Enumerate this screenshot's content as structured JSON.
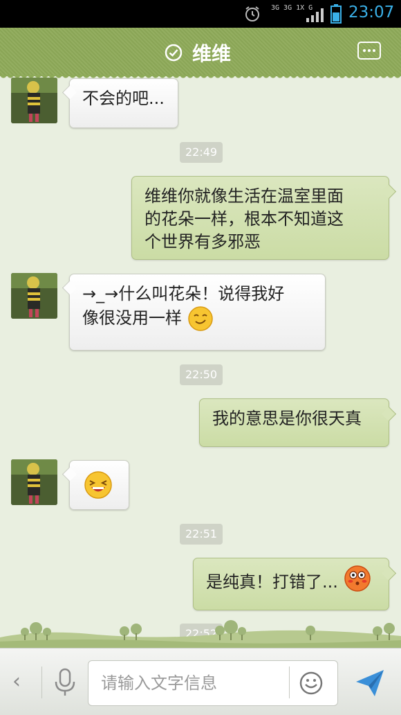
{
  "status_bar": {
    "network_top": "3G 3G 1X G",
    "time": "23:07",
    "icons": [
      "alarm-icon",
      "signal-icon",
      "battery-icon"
    ]
  },
  "header": {
    "title": "维维",
    "status_icon": "check-circle-icon",
    "menu_icon": "more-icon",
    "color": "#8eaa59"
  },
  "messages": [
    {
      "side": "in",
      "text": "不会的吧..."
    },
    {
      "type": "time",
      "text": "22:49"
    },
    {
      "side": "out",
      "lines": [
        "维维你就像生活在温室里面",
        "的花朵一样，根本不知道这",
        "个世界有多邪恶"
      ]
    },
    {
      "side": "in",
      "lines": [
        "→_→什么叫花朵！说得我好",
        "像很没用一样"
      ],
      "emoji": "grin-emoji"
    },
    {
      "type": "time",
      "text": "22:50"
    },
    {
      "side": "out",
      "text": "我的意思是你很天真"
    },
    {
      "side": "in",
      "emoji": "laugh-emoji"
    },
    {
      "type": "time",
      "text": "22:51"
    },
    {
      "side": "out",
      "text": "是纯真！打错了...",
      "emoji": "blush-emoji"
    },
    {
      "type": "time",
      "text": "22:52"
    }
  ],
  "input_bar": {
    "back_label": "‹",
    "placeholder": "请输入文字信息",
    "icons": [
      "back-icon",
      "microphone-icon",
      "smiley-icon",
      "send-icon"
    ]
  },
  "colors": {
    "accent_header": "#8eaa59",
    "bubble_out": "#cbdca5",
    "bubble_in": "#ffffff",
    "background": "#e9efe0",
    "clock": "#3ab0e8"
  }
}
